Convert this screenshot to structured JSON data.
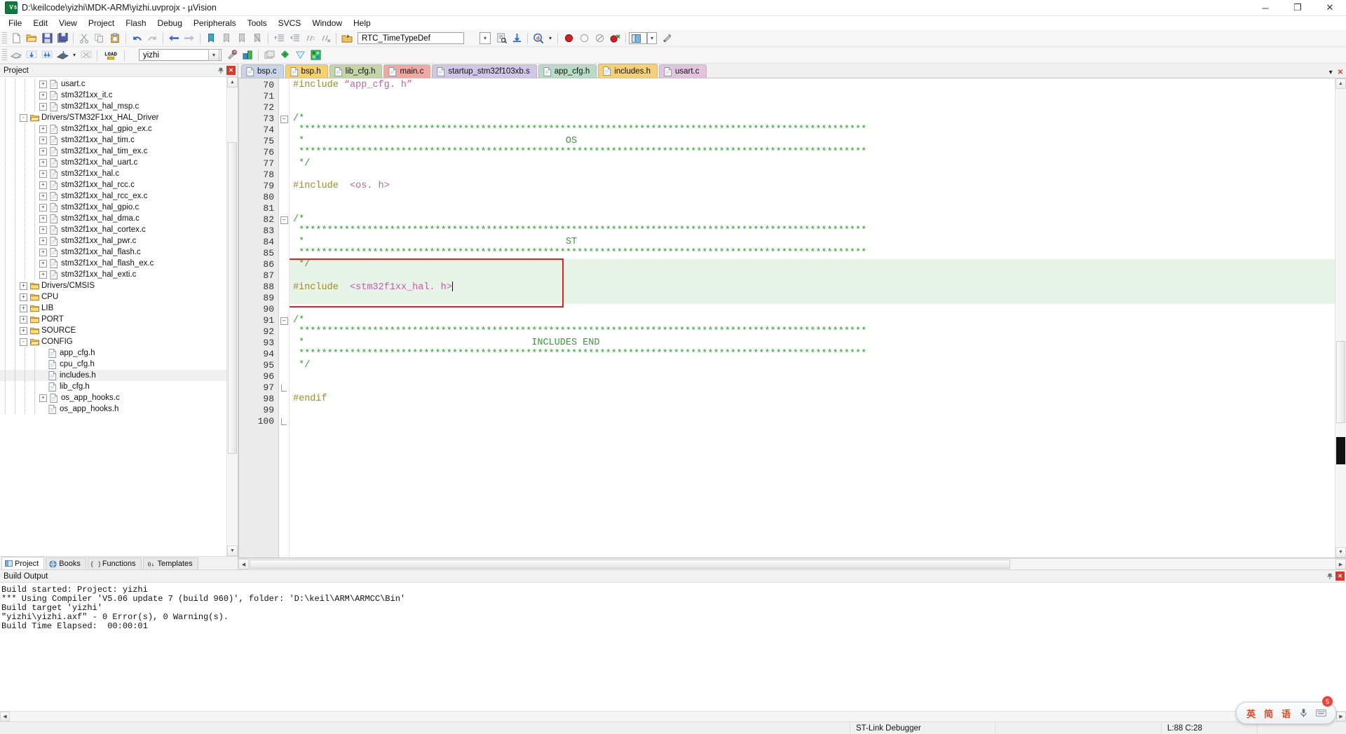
{
  "window": {
    "title": "D:\\keilcode\\yizhi\\MDK-ARM\\yizhi.uvprojx - µVision",
    "icon": "uvision-logo-icon",
    "minimize": "─",
    "maximize": "❐",
    "close": "✕"
  },
  "menu": [
    "File",
    "Edit",
    "View",
    "Project",
    "Flash",
    "Debug",
    "Peripherals",
    "Tools",
    "SVCS",
    "Window",
    "Help"
  ],
  "toolbar1": {
    "search_value": "RTC_TimeTypeDef",
    "search_placeholder": "",
    "icons": [
      "new-file-icon",
      "open-file-icon",
      "save-icon",
      "save-all-icon",
      "cut-icon",
      "copy-icon",
      "paste-icon",
      "undo-icon",
      "redo-icon",
      "navigate-back-icon",
      "navigate-forward-icon",
      "bookmark-toggle-icon",
      "bookmark-prev-icon",
      "bookmark-next-icon",
      "bookmark-clear-icon",
      "indent-icon",
      "outdent-icon",
      "comment-icon",
      "uncomment-icon",
      "find-in-files-icon",
      "browse-symbol-icon",
      "insert-bookmark-icon",
      "find-icon",
      "breakpoint-icon",
      "breakpoint-disable-icon",
      "breakpoint-disable-all-icon",
      "breakpoint-kill-all-icon",
      "window-layout-icon",
      "configure-icon"
    ]
  },
  "toolbar2": {
    "target_value": "yizhi",
    "icons": [
      "translate-icon",
      "build-icon",
      "rebuild-icon",
      "batch-build-icon",
      "stop-build-icon",
      "load-icon",
      "target-options-icon",
      "manage-runtime-icon",
      "debug-start-icon",
      "window-split-icon",
      "multi-project-icon",
      "project-items-icon",
      "components-icon",
      "packs-icon"
    ],
    "load_label": "LOAD"
  },
  "project": {
    "pane_title": "Project",
    "pin_icon": "pin-icon",
    "close_icon": "close-icon",
    "tree": [
      {
        "label": "usart.c",
        "type": "file",
        "depth": 2,
        "expander": "+"
      },
      {
        "label": "stm32f1xx_it.c",
        "type": "file",
        "depth": 2,
        "expander": "+"
      },
      {
        "label": "stm32f1xx_hal_msp.c",
        "type": "file",
        "depth": 2,
        "expander": "+"
      },
      {
        "label": "Drivers/STM32F1xx_HAL_Driver",
        "type": "folder-open",
        "depth": 1,
        "expander": "-"
      },
      {
        "label": "stm32f1xx_hal_gpio_ex.c",
        "type": "file",
        "depth": 2,
        "expander": "+"
      },
      {
        "label": "stm32f1xx_hal_tim.c",
        "type": "file",
        "depth": 2,
        "expander": "+"
      },
      {
        "label": "stm32f1xx_hal_tim_ex.c",
        "type": "file",
        "depth": 2,
        "expander": "+"
      },
      {
        "label": "stm32f1xx_hal_uart.c",
        "type": "file",
        "depth": 2,
        "expander": "+"
      },
      {
        "label": "stm32f1xx_hal.c",
        "type": "file",
        "depth": 2,
        "expander": "+"
      },
      {
        "label": "stm32f1xx_hal_rcc.c",
        "type": "file",
        "depth": 2,
        "expander": "+"
      },
      {
        "label": "stm32f1xx_hal_rcc_ex.c",
        "type": "file",
        "depth": 2,
        "expander": "+"
      },
      {
        "label": "stm32f1xx_hal_gpio.c",
        "type": "file",
        "depth": 2,
        "expander": "+"
      },
      {
        "label": "stm32f1xx_hal_dma.c",
        "type": "file",
        "depth": 2,
        "expander": "+"
      },
      {
        "label": "stm32f1xx_hal_cortex.c",
        "type": "file",
        "depth": 2,
        "expander": "+"
      },
      {
        "label": "stm32f1xx_hal_pwr.c",
        "type": "file",
        "depth": 2,
        "expander": "+"
      },
      {
        "label": "stm32f1xx_hal_flash.c",
        "type": "file",
        "depth": 2,
        "expander": "+"
      },
      {
        "label": "stm32f1xx_hal_flash_ex.c",
        "type": "file",
        "depth": 2,
        "expander": "+"
      },
      {
        "label": "stm32f1xx_hal_exti.c",
        "type": "file",
        "depth": 2,
        "expander": "+"
      },
      {
        "label": "Drivers/CMSIS",
        "type": "folder",
        "depth": 1,
        "expander": "+"
      },
      {
        "label": "CPU",
        "type": "folder",
        "depth": 1,
        "expander": "+"
      },
      {
        "label": "LIB",
        "type": "folder",
        "depth": 1,
        "expander": "+"
      },
      {
        "label": "PORT",
        "type": "folder",
        "depth": 1,
        "expander": "+"
      },
      {
        "label": "SOURCE",
        "type": "folder",
        "depth": 1,
        "expander": "+"
      },
      {
        "label": "CONFIG",
        "type": "folder-open",
        "depth": 1,
        "expander": "-"
      },
      {
        "label": "app_cfg.h",
        "type": "file",
        "depth": 2,
        "expander": ""
      },
      {
        "label": "cpu_cfg.h",
        "type": "file",
        "depth": 2,
        "expander": ""
      },
      {
        "label": "includes.h",
        "type": "file",
        "depth": 2,
        "expander": "",
        "selected": true
      },
      {
        "label": "lib_cfg.h",
        "type": "file",
        "depth": 2,
        "expander": ""
      },
      {
        "label": "os_app_hooks.c",
        "type": "file",
        "depth": 2,
        "expander": "+"
      },
      {
        "label": "os_app_hooks.h",
        "type": "file",
        "depth": 2,
        "expander": ""
      }
    ],
    "tabs": [
      {
        "label": "Project",
        "icon": "project-icon",
        "active": true
      },
      {
        "label": "Books",
        "icon": "books-icon",
        "active": false
      },
      {
        "label": "Functions",
        "icon": "functions-icon",
        "active": false
      },
      {
        "label": "Templates",
        "icon": "templates-icon",
        "active": false
      }
    ]
  },
  "editor": {
    "tabs": [
      {
        "label": "bsp.c",
        "color": "#c8d4ea",
        "active": false
      },
      {
        "label": "bsp.h",
        "color": "#f5d16a",
        "active": false
      },
      {
        "label": "lib_cfg.h",
        "color": "#c6d5a6",
        "active": false
      },
      {
        "label": "main.c",
        "color": "#eda9a2",
        "active": false
      },
      {
        "label": "startup_stm32f103xb.s",
        "color": "#cfc6e8",
        "active": false
      },
      {
        "label": "app_cfg.h",
        "color": "#b9dcc6",
        "active": false
      },
      {
        "label": "includes.h",
        "color": "#f3d07a",
        "active": true
      },
      {
        "label": "usart.c",
        "color": "#e3c3e0",
        "active": false
      }
    ],
    "tab_controls": {
      "scroll_down": "▾",
      "close": "✕"
    },
    "first_line": 70,
    "lines": [
      {
        "n": 70,
        "segments": [
          {
            "t": "#include ",
            "c": "kw"
          },
          {
            "t": "“app_cfg. h”",
            "c": "str"
          }
        ]
      },
      {
        "n": 71,
        "segments": []
      },
      {
        "n": 72,
        "segments": []
      },
      {
        "n": 73,
        "segments": [
          {
            "t": "/*",
            "c": "cmt"
          }
        ],
        "fold": "-"
      },
      {
        "n": 74,
        "segments": [
          {
            "t": " ****************************************************************************************************",
            "c": "cmt"
          }
        ]
      },
      {
        "n": 75,
        "segments": [
          {
            "t": " *                                              OS",
            "c": "cmt"
          }
        ]
      },
      {
        "n": 76,
        "segments": [
          {
            "t": " ****************************************************************************************************",
            "c": "cmt"
          }
        ]
      },
      {
        "n": 77,
        "segments": [
          {
            "t": " */",
            "c": "cmt"
          }
        ]
      },
      {
        "n": 78,
        "segments": []
      },
      {
        "n": 79,
        "segments": [
          {
            "t": "#include  ",
            "c": "kw"
          },
          {
            "t": "<os. h>",
            "c": "str"
          }
        ]
      },
      {
        "n": 80,
        "segments": []
      },
      {
        "n": 81,
        "segments": []
      },
      {
        "n": 82,
        "segments": [
          {
            "t": "/*",
            "c": "cmt"
          }
        ],
        "fold": "-"
      },
      {
        "n": 83,
        "segments": [
          {
            "t": " ****************************************************************************************************",
            "c": "cmt"
          }
        ]
      },
      {
        "n": 84,
        "segments": [
          {
            "t": " *                                              ST",
            "c": "cmt"
          }
        ]
      },
      {
        "n": 85,
        "segments": [
          {
            "t": " ****************************************************************************************************",
            "c": "cmt"
          }
        ]
      },
      {
        "n": 86,
        "segments": [
          {
            "t": " */",
            "c": "cmt"
          }
        ],
        "hl": true
      },
      {
        "n": 87,
        "segments": [],
        "hl": true
      },
      {
        "n": 88,
        "segments": [
          {
            "t": "#include  ",
            "c": "kw"
          },
          {
            "t": "<stm32f1xx_hal. h>",
            "c": "str"
          }
        ],
        "hl": true,
        "caret": true
      },
      {
        "n": 89,
        "segments": [],
        "hl": true
      },
      {
        "n": 90,
        "segments": []
      },
      {
        "n": 91,
        "segments": [
          {
            "t": "/*",
            "c": "cmt"
          }
        ],
        "fold": "-"
      },
      {
        "n": 92,
        "segments": [
          {
            "t": " ****************************************************************************************************",
            "c": "cmt"
          }
        ]
      },
      {
        "n": 93,
        "segments": [
          {
            "t": " *                                        INCLUDES END",
            "c": "cmt"
          }
        ]
      },
      {
        "n": 94,
        "segments": [
          {
            "t": " ****************************************************************************************************",
            "c": "cmt"
          }
        ]
      },
      {
        "n": 95,
        "segments": [
          {
            "t": " */",
            "c": "cmt"
          }
        ]
      },
      {
        "n": 96,
        "segments": []
      },
      {
        "n": 97,
        "segments": [],
        "fold": "end"
      },
      {
        "n": 98,
        "segments": [
          {
            "t": "#endif",
            "c": "kw"
          }
        ]
      },
      {
        "n": 99,
        "segments": []
      },
      {
        "n": 100,
        "segments": [],
        "fold": "end"
      }
    ],
    "highlight_box_color": "#e2231a"
  },
  "build": {
    "title": "Build Output",
    "pin_icon": "pin-icon",
    "close_icon": "close-icon",
    "lines": [
      "Build started: Project: yizhi",
      "*** Using Compiler 'V5.06 update 7 (build 960)', folder: 'D:\\keil\\ARM\\ARMCC\\Bin'",
      "Build target 'yizhi'",
      "\"yizhi\\yizhi.axf\" - 0 Error(s), 0 Warning(s).",
      "Build Time Elapsed:  00:00:01"
    ]
  },
  "statusbar": {
    "debugger": "ST-Link Debugger",
    "cursor": "L:88 C:28",
    "left": ""
  },
  "ime": {
    "keys": [
      "英",
      "简",
      "语"
    ],
    "badge": "5",
    "mic_icon": "microphone-icon",
    "kb_icon": "keyboard-icon"
  },
  "colors": {
    "accent": "#e2231a",
    "comment": "#3a9a3a",
    "keyword": "#9b8b2f",
    "string": "#c05fa8",
    "highlight_line": "#e8f3e8"
  }
}
